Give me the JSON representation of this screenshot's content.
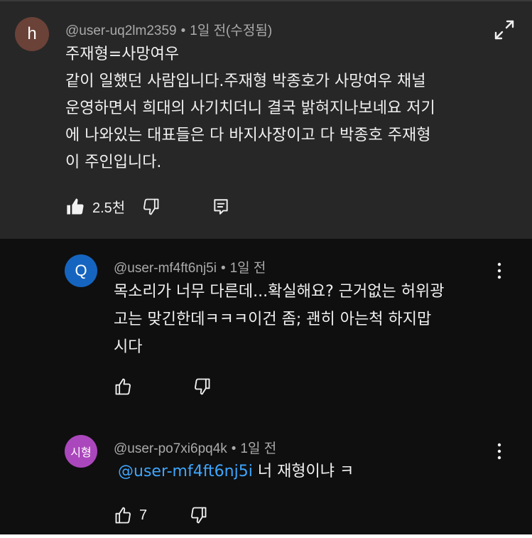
{
  "comments": [
    {
      "avatar_letter": "h",
      "username": "@user-uq2lm2359",
      "dot": "•",
      "time": "1일 전(수정됨)",
      "lines": [
        "주재형=사망여우",
        "같이 일했던 사람입니다.주재형 박종호가 사망여우 채널",
        "운영하면서 희대의 사기치더니 결국 밝혀지나보네요 저기",
        "에 나와있는 대표들은 다 바지사장이고 다 박종호 주재형",
        "이  주인입니다."
      ],
      "like_count": "2.5천"
    },
    {
      "avatar_letter": "Q",
      "username": "@user-mf4ft6nj5i",
      "dot": "•",
      "time": "1일 전",
      "lines": [
        "목소리가 너무 다른데...확실해요? 근거없는 허위광",
        "고는 맞긴한데ㅋㅋㅋ이건 좀;  괜히 아는척 하지맙",
        "시다"
      ]
    },
    {
      "avatar_letter": "시형",
      "username": "@user-po7xi6pq4k",
      "dot": "•",
      "time": "1일 전",
      "mention": "@user-mf4ft6nj5i",
      "text": " 너 재형이냐 ㅋ",
      "like_count": "7"
    }
  ],
  "colors": {
    "top_bg": "#272727",
    "reply_bg": "#0f0f0f",
    "mention": "#3ea6ff",
    "avatar_h": "#6b4238",
    "avatar_q": "#1565c0",
    "avatar_s": "#ab47bc"
  },
  "icons": [
    "expand-icon",
    "like-filled-icon",
    "dislike-icon",
    "reply-icon",
    "like-icon",
    "more-vert-icon"
  ]
}
